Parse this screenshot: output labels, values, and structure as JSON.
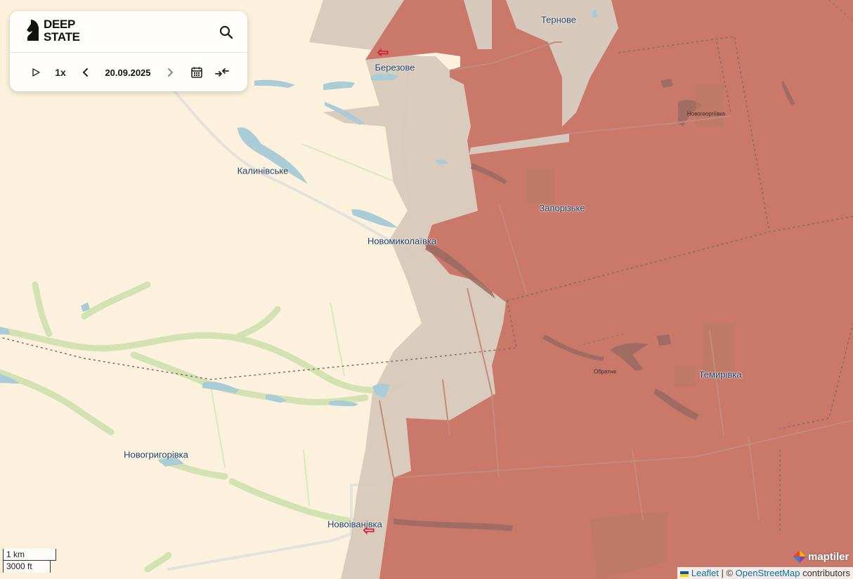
{
  "app": {
    "logo_line1": "DEEP",
    "logo_line2": "STATE"
  },
  "controls": {
    "speed": "1x",
    "date": "20.09.2025",
    "icons": [
      "play-icon",
      "chevron-left-icon",
      "chevron-right-icon",
      "calendar-icon",
      "compare-icon",
      "search-icon"
    ]
  },
  "places": [
    {
      "id": "ternove",
      "label": "Тернове"
    },
    {
      "id": "berezove",
      "label": "Березове"
    },
    {
      "id": "novoheorhiivka",
      "label": "Новогеоргіївка"
    },
    {
      "id": "kalynivske",
      "label": "Калинівське"
    },
    {
      "id": "zaporizke",
      "label": "Запорізьке"
    },
    {
      "id": "novomykolaivka",
      "label": "Новомиколаївка"
    },
    {
      "id": "obratne",
      "label": "Обратне"
    },
    {
      "id": "temyrivka",
      "label": "Темирівка"
    },
    {
      "id": "novohryhorivka",
      "label": "Новогригорівка"
    },
    {
      "id": "novoivanivka",
      "label": "Новоіванівка"
    }
  ],
  "scale": {
    "metric": "1 km",
    "imperial": "3000 ft"
  },
  "attribution": {
    "leaflet": "Leaflet",
    "separator": " | © ",
    "osm": "OpenStreetMap",
    "suffix": " contributors",
    "maptiler": "maptiler"
  },
  "colors": {
    "background": "#fbf1dc",
    "occupied": "#c9786a",
    "contested": "#d7c9bb",
    "water": "#a9ccd6",
    "vegetation": "#cfe0b0",
    "attack_arrow": "#d1203a"
  }
}
